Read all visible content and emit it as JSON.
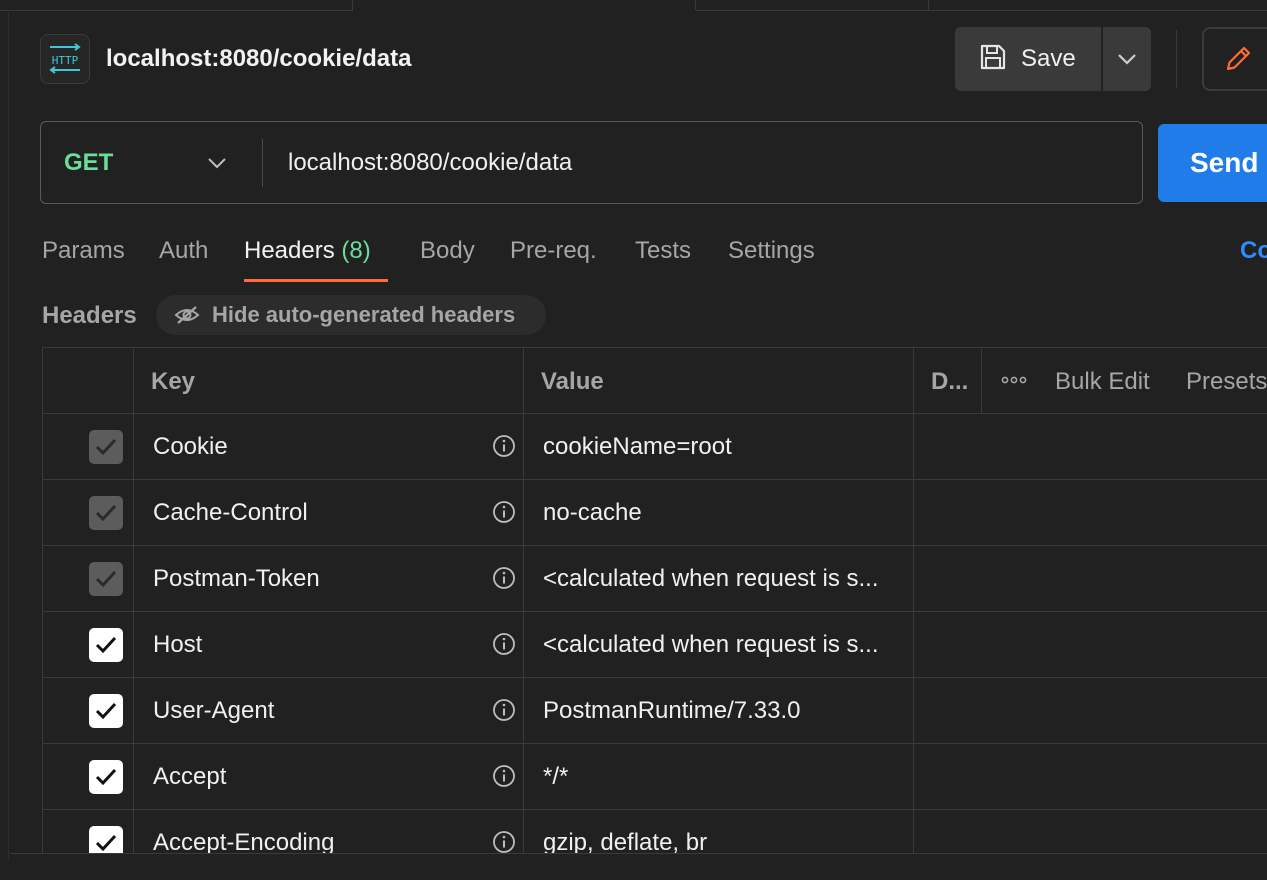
{
  "request": {
    "title": "localhost:8080/cookie/data",
    "method": "GET",
    "url": "localhost:8080/cookie/data"
  },
  "toolbar": {
    "save_label": "Save"
  },
  "send_label": "Send",
  "tabs": [
    {
      "label": "Params"
    },
    {
      "label": "Auth"
    },
    {
      "label": "Headers",
      "count": "(8)",
      "active": true
    },
    {
      "label": "Body"
    },
    {
      "label": "Pre-req."
    },
    {
      "label": "Tests"
    },
    {
      "label": "Settings"
    }
  ],
  "cookies_link": "Co",
  "headers_section": {
    "label": "Headers",
    "hide_button": "Hide auto-generated headers"
  },
  "table": {
    "columns": {
      "key": "Key",
      "value": "Value",
      "description": "D...",
      "bulk_edit": "Bulk Edit",
      "presets": "Presets"
    },
    "rows": [
      {
        "key": "Cookie",
        "value": "cookieName=root",
        "checked": true,
        "locked": true
      },
      {
        "key": "Cache-Control",
        "value": "no-cache",
        "checked": true,
        "locked": true
      },
      {
        "key": "Postman-Token",
        "value": "<calculated when request is s...",
        "checked": true,
        "locked": true
      },
      {
        "key": "Host",
        "value": "<calculated when request is s...",
        "checked": true,
        "locked": false
      },
      {
        "key": "User-Agent",
        "value": "PostmanRuntime/7.33.0",
        "checked": true,
        "locked": false
      },
      {
        "key": "Accept",
        "value": "*/*",
        "checked": true,
        "locked": false
      },
      {
        "key": "Accept-Encoding",
        "value": "gzip, deflate, br",
        "checked": true,
        "locked": false
      }
    ]
  },
  "colors": {
    "method_get": "#6bdd9a",
    "send_button": "#1f7ce8",
    "active_tab_underline": "#ff6c37",
    "edit_icon": "#ff6c37",
    "http_icon": "#3fc6d9"
  }
}
